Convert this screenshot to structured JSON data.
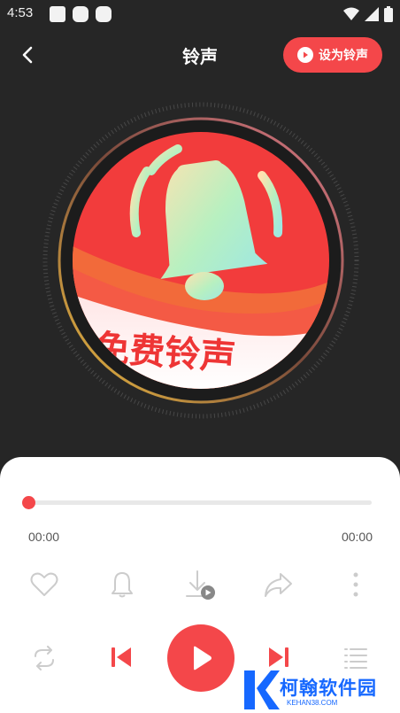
{
  "status_bar": {
    "time": "4:53"
  },
  "header": {
    "title": "铃声",
    "set_ringtone_label": "设为铃声"
  },
  "cover": {
    "banner_text": "免费铃声"
  },
  "player": {
    "progress": 0,
    "current_time": "00:00",
    "total_time": "00:00"
  },
  "watermark": {
    "title": "柯翰软件园",
    "subtitle": "KEHAN38.COM"
  },
  "colors": {
    "accent": "#f4474a",
    "background": "#262626",
    "sheet": "#ffffff"
  }
}
